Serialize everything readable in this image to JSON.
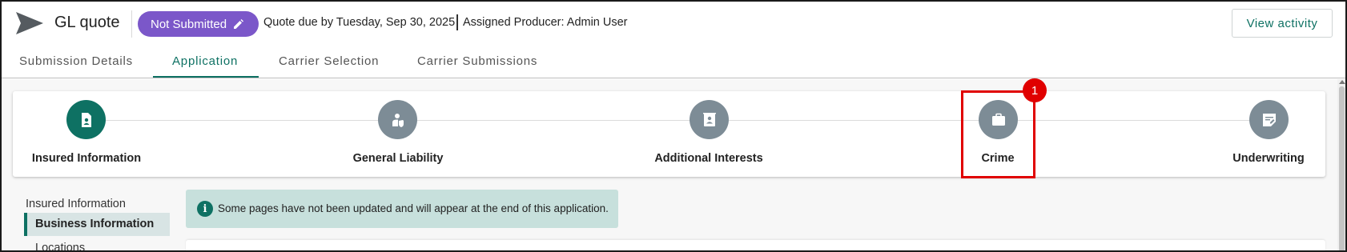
{
  "header": {
    "logo_icon": "paper-plane-icon",
    "title": "GL quote",
    "status": "Not Submitted",
    "status_icon": "pencil-icon",
    "status_color": "#7b57c9",
    "due_text": "Quote due by Tuesday, Sep 30, 2025",
    "producer_text": "Assigned Producer: Admin User",
    "view_activity_label": "View activity"
  },
  "tabs": [
    {
      "label": "Submission Details",
      "active": false
    },
    {
      "label": "Application",
      "active": true
    },
    {
      "label": "Carrier Selection",
      "active": false
    },
    {
      "label": "Carrier Submissions",
      "active": false
    }
  ],
  "stepper": {
    "steps": [
      {
        "label": "Insured Information",
        "icon": "document-person-icon",
        "active": true
      },
      {
        "label": "General Liability",
        "icon": "person-shield-icon",
        "active": false
      },
      {
        "label": "Additional Interests",
        "icon": "contact-card-icon",
        "active": false
      },
      {
        "label": "Crime",
        "icon": "briefcase-icon",
        "active": false
      },
      {
        "label": "Underwriting",
        "icon": "note-edit-icon",
        "active": false
      }
    ],
    "highlight_badge": "1"
  },
  "sidebar": {
    "heading": "Insured Information",
    "items": [
      {
        "label": "Business Information",
        "active": true
      },
      {
        "label": "Locations",
        "active": false
      }
    ]
  },
  "info_banner": {
    "icon": "info-icon",
    "text": "Some pages have not been updated and will appear at the end of this application."
  },
  "colors": {
    "accent": "#0e7163",
    "step_inactive": "#7d8c96",
    "highlight": "#e00000"
  }
}
